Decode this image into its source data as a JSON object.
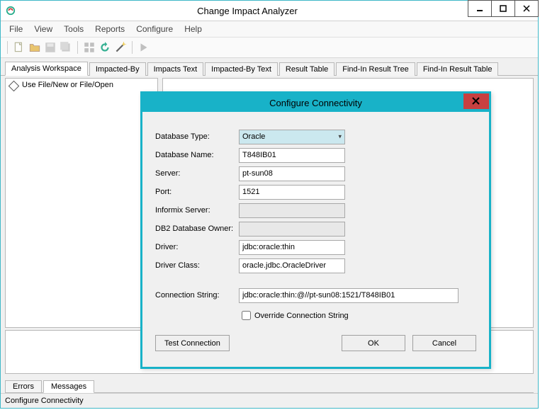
{
  "window": {
    "title": "Change Impact Analyzer"
  },
  "menu": {
    "file": "File",
    "view": "View",
    "tools": "Tools",
    "reports": "Reports",
    "configure": "Configure",
    "help": "Help"
  },
  "tabs": {
    "analysis_workspace": "Analysis Workspace",
    "impacted_by": "Impacted-By",
    "impacts_text": "Impacts Text",
    "impacted_by_text": "Impacted-By Text",
    "result_table": "Result Table",
    "find_in_result_tree": "Find-In Result Tree",
    "find_in_result_table": "Find-In Result Table"
  },
  "workspace": {
    "left_hint": "Use File/New or File/Open"
  },
  "bottom_tabs": {
    "errors": "Errors",
    "messages": "Messages"
  },
  "statusbar": {
    "text": "Configure Connectivity"
  },
  "dialog": {
    "title": "Configure Connectivity",
    "labels": {
      "database_type": "Database Type:",
      "database_name": "Database Name:",
      "server": "Server:",
      "port": "Port:",
      "informix_server": "Informix Server:",
      "db2_owner": "DB2 Database Owner:",
      "driver": "Driver:",
      "driver_class": "Driver Class:",
      "connection_string": "Connection String:",
      "override": "Override Connection String"
    },
    "values": {
      "database_type": "Oracle",
      "database_name": "T848IB01",
      "server": "pt-sun08",
      "port": "1521",
      "informix_server": "",
      "db2_owner": "",
      "driver": "jdbc:oracle:thin",
      "driver_class": "oracle.jdbc.OracleDriver",
      "connection_string": "jdbc:oracle:thin:@//pt-sun08:1521/T848IB01"
    },
    "buttons": {
      "test": "Test Connection",
      "ok": "OK",
      "cancel": "Cancel"
    }
  }
}
